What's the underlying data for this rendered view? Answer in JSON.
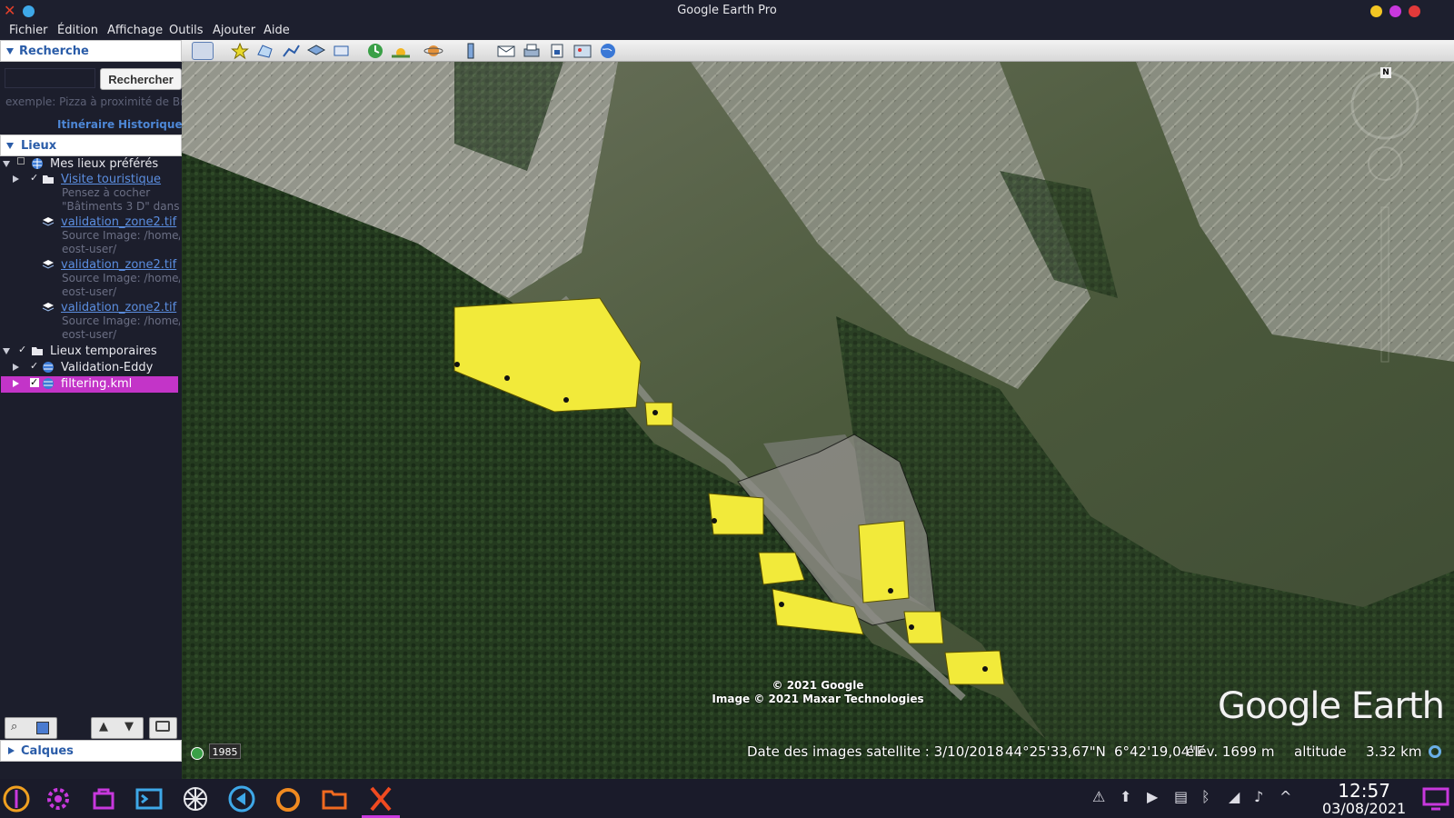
{
  "window": {
    "title": "Google Earth Pro"
  },
  "menu": [
    "Fichier",
    "Édition",
    "Affichage",
    "Outils",
    "Ajouter",
    "Aide"
  ],
  "search": {
    "header": "Recherche",
    "button": "Rechercher",
    "hint": "exemple: Pizza à proximité de Bre",
    "tab_itinerary": "Itinéraire",
    "tab_history": "Historique"
  },
  "places": {
    "header": "Lieux",
    "my_places": "Mes lieux préférés",
    "tour": {
      "label": "Visite touristique",
      "desc1": "Pensez à cocher",
      "desc2": "\"Bâtiments 3 D\" dans"
    },
    "layers": [
      {
        "label": "validation_zone2.tif",
        "desc1": "Source Image: /home/",
        "desc2": "eost-user/"
      },
      {
        "label": "validation_zone2.tif",
        "desc1": "Source Image: /home/",
        "desc2": "eost-user/"
      },
      {
        "label": "validation_zone2.tif",
        "desc1": "Source Image: /home/",
        "desc2": "eost-user/"
      }
    ],
    "temp_places": "Lieux temporaires",
    "validation": "Validation-Eddy",
    "filtering": "filtering.kml"
  },
  "layers_header": "Calques",
  "map": {
    "historic_year": "1985",
    "copyright1": "© 2021 Google",
    "copyright2": "Image © 2021 Maxar Technologies",
    "logo": "Google Earth",
    "compass_n": "N",
    "status": {
      "imagery_date": "Date des images satellite : 3/10/2018",
      "lat": "44°25'33,67\"N",
      "lon": "6°42'19,04\"E",
      "elev": "élév. 1699 m",
      "altitude_label": "altitude",
      "altitude_value": "3.32 km"
    }
  },
  "taskbar": {
    "time": "12:57",
    "date": "03/08/2021"
  },
  "colors": {
    "pin": "#f2ea3a",
    "selection": "#c334c8",
    "link": "#5b8ee0",
    "header_text": "#2a5ca8"
  }
}
